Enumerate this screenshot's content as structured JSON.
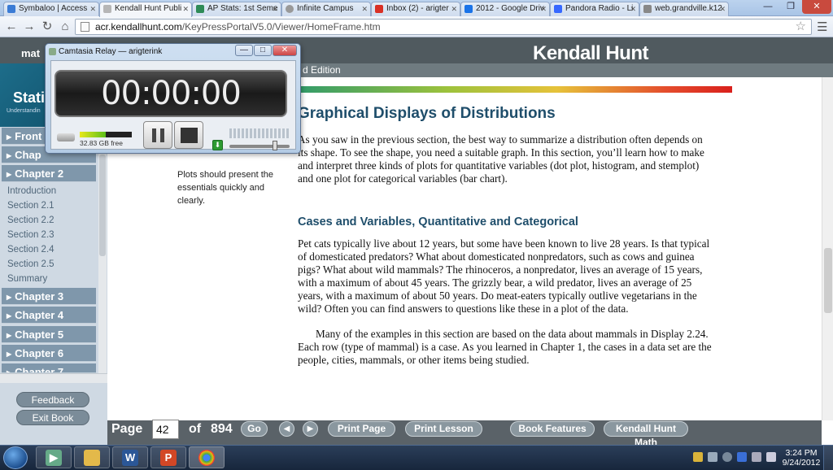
{
  "browser": {
    "tabs": [
      {
        "title": "Symbaloo | Access",
        "color": "#3a7bd5"
      },
      {
        "title": "Kendall Hunt Publi",
        "color": "#b6b6b6"
      },
      {
        "title": "AP Stats: 1st Seme",
        "color": "#2e8b57"
      },
      {
        "title": "Infinite Campus",
        "color": "#999999"
      },
      {
        "title": "Inbox (2) - arigter",
        "color": "#d93025"
      },
      {
        "title": "2012 - Google Driv",
        "color": "#1a73e8"
      },
      {
        "title": "Pandora Radio - Li",
        "color": "#3668ff"
      },
      {
        "title": "web.grandville.k12",
        "color": "#888888"
      }
    ],
    "url_host": "acr.kendallhunt.com",
    "url_path": "/KeyPressPortalV5.0/Viewer/HomeFrame.htm"
  },
  "camtasia": {
    "title": "Camtasia Relay — arigterink",
    "timer": "00:00:00",
    "disk_free": "32.83 GB free",
    "disk_level": 0.5,
    "volume_level": 0.75
  },
  "site": {
    "logo": "Kendall Hunt",
    "left_header": "mat",
    "edition": "d Edition",
    "book_title": "Stati",
    "book_subtitle": "Understandin"
  },
  "sidebar": {
    "chapters": [
      "Front",
      "Chap",
      "Chapter 2",
      "Chapter 3",
      "Chapter 4",
      "Chapter 5",
      "Chapter 6",
      "Chapter 7"
    ],
    "sections": [
      "Introduction",
      "Section 2.1",
      "Section 2.2",
      "Section 2.3",
      "Section 2.4",
      "Section 2.5",
      "Summary"
    ],
    "feedback": "Feedback",
    "exit": "Exit Book"
  },
  "content": {
    "margin_note": "Plots should present the essentials quickly and clearly.",
    "heading1": "Graphical Displays of Distributions",
    "para1": "As you saw in the previous section, the best way to summarize a distribution often depends on its shape. To see the shape, you need a suitable graph. In this section, you’ll learn how to make and interpret three kinds of plots for quantitative variables (dot plot, histogram, and stemplot) and one plot for categorical variables (bar chart).",
    "heading2": "Cases and Variables, Quantitative and Categorical",
    "para2": "Pet cats typically live about 12 years, but some have been known to live 28 years. Is that typical of domesticated predators? What about domesticated nonpredators, such as cows and guinea pigs? What about wild mammals? The rhinoceros, a nonpredator, lives an average of 15 years, with a maximum of about 45 years. The grizzly bear, a wild predator, lives an average of 25 years, with a maximum of about 50 years. Do meat-eaters typically outlive vegetarians in the wild? Often you can find answers to questions like these in a plot of the data.",
    "para3": "Many of the examples in this section are based on the data about mammals in Display 2.24. Each row (type of mammal) is a case. As you learned in Chapter 1, the cases in a data set are the people, cities, mammals, or other items being studied."
  },
  "bottombar": {
    "page_label": "Page",
    "page_value": "42",
    "of_label": "of",
    "total": "894",
    "go": "Go",
    "print_page": "Print Page",
    "print_lesson": "Print Lesson",
    "book_features": "Book Features",
    "kh_math": "Kendall Hunt Math"
  },
  "taskbar": {
    "time": "3:24 PM",
    "date": "9/24/2012"
  }
}
